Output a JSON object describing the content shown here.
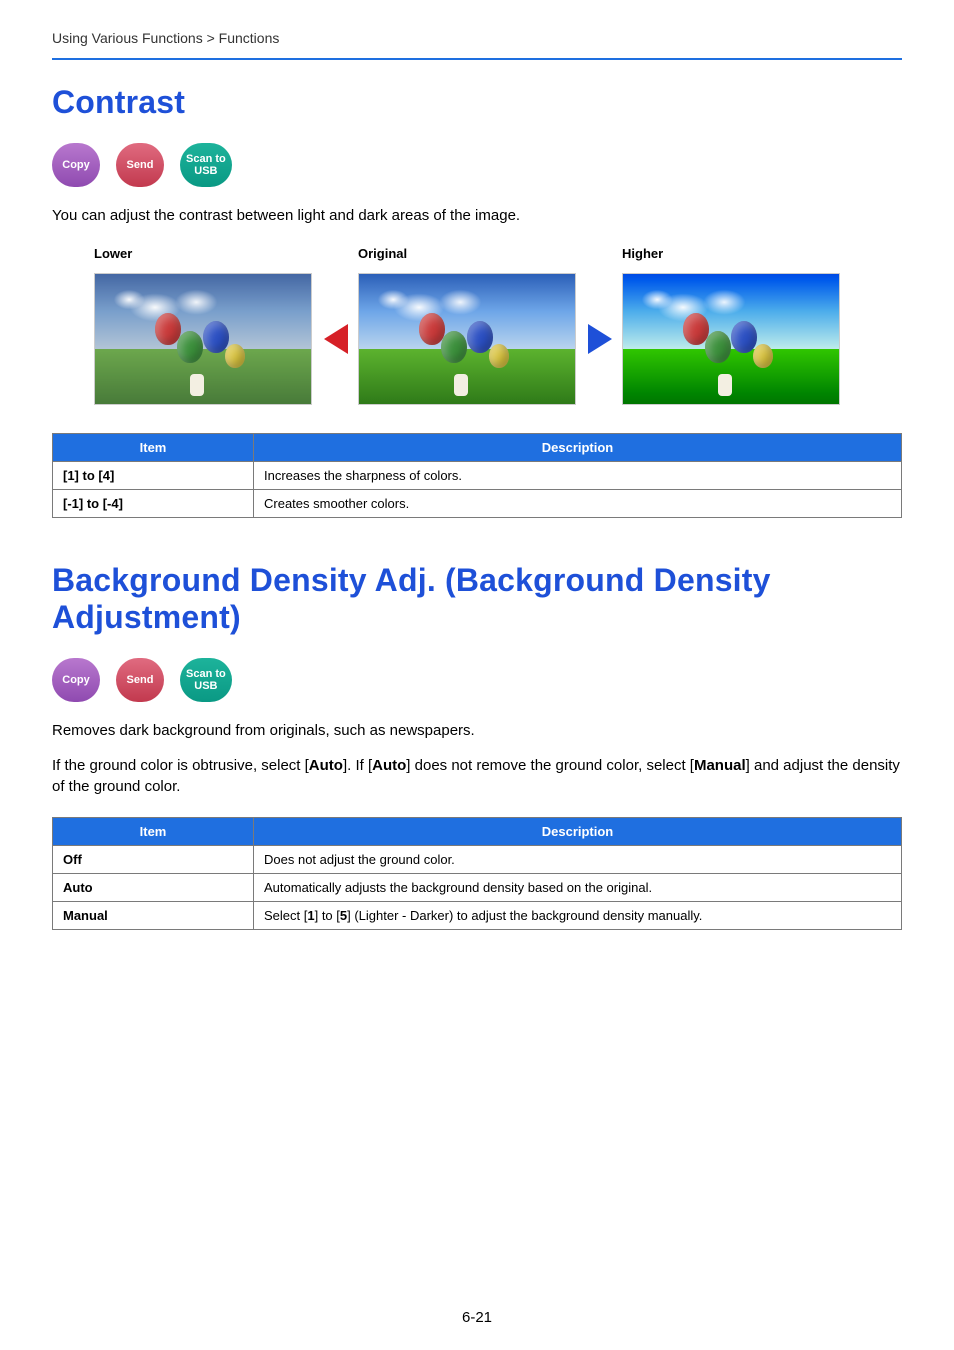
{
  "breadcrumb": "Using Various Functions > Functions",
  "pageNumber": "6-21",
  "pills": {
    "copy": "Copy",
    "send": "Send",
    "scan": "Scan to\nUSB"
  },
  "contrast": {
    "heading": "Contrast",
    "intro": "You can adjust the contrast between light and dark areas of the image.",
    "labels": {
      "lower": "Lower",
      "original": "Original",
      "higher": "Higher"
    },
    "table": {
      "headers": {
        "item": "Item",
        "description": "Description"
      },
      "rows": [
        {
          "item": "[1] to [4]",
          "desc": "Increases the sharpness of colors."
        },
        {
          "item": "[-1] to [-4]",
          "desc": "Creates smoother colors."
        }
      ]
    }
  },
  "bgdensity": {
    "heading": "Background Density Adj. (Background Density Adjustment)",
    "p1": "Removes dark background from originals, such as newspapers.",
    "p2_parts": {
      "a": "If the ground color is obtrusive, select [",
      "auto1": "Auto",
      "b": "]. If [",
      "auto2": "Auto",
      "c": "] does not remove the ground color, select [",
      "manual": "Manual",
      "d": "] and adjust the density of the ground color."
    },
    "table": {
      "headers": {
        "item": "Item",
        "description": "Description"
      },
      "rows": [
        {
          "item": "Off",
          "desc": "Does not adjust the ground color."
        },
        {
          "item": "Auto",
          "desc": "Automatically adjusts the background density based on the original."
        },
        {
          "item": "Manual",
          "desc_parts": {
            "a": "Select [",
            "one": "1",
            "b": "] to [",
            "five": "5",
            "c": "] (Lighter - Darker) to adjust the background density manually."
          }
        }
      ]
    }
  }
}
